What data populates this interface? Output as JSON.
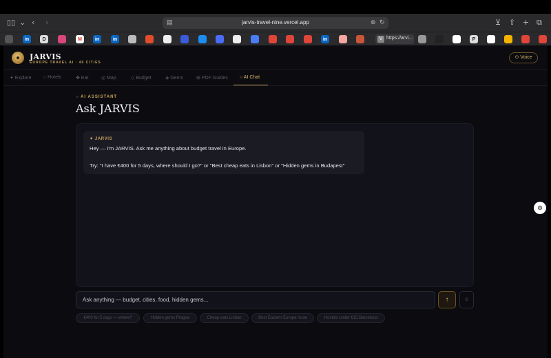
{
  "browser": {
    "url": "jarvis-travel-nine.vercel.app",
    "active_tab_label": "https://arvi..."
  },
  "app": {
    "brand_name": "JARVIS",
    "brand_subtitle": "EUROPE TRAVEL AI · 40 CITIES",
    "voice_button": "⊙ Voice"
  },
  "nav": {
    "items": [
      {
        "label": "✦ Explore"
      },
      {
        "label": "⌂ Hotels"
      },
      {
        "label": "✤ Eat"
      },
      {
        "label": "◎ Map"
      },
      {
        "label": "◇ Budget"
      },
      {
        "label": "◈ Gems"
      },
      {
        "label": "⊞ PDF Guides"
      },
      {
        "label": "○ AI Chat"
      }
    ]
  },
  "main": {
    "eyebrow": "○ AI ASSISTANT",
    "title": "Ask JARVIS"
  },
  "chat": {
    "messages": [
      {
        "sender": "✦ JARVIS",
        "line1": "Hey — I'm JARVIS. Ask me anything about budget travel in Europe.",
        "line2": "Try: \"I have €400 for 5 days, where should I go?\" or \"Best cheap eats in Lisbon\" or \"Hidden gems in Budapest\""
      }
    ],
    "input_placeholder": "Ask anything — budget, cities, food, hidden gems...",
    "send_icon": "↑",
    "mic_icon": "⊙"
  },
  "suggestions": [
    "€400 for 5 days — where?",
    "Hidden gems Prague",
    "Cheap eats Lisbon",
    "Best Eastern Europe route",
    "Hostels under €15 Barcelona"
  ],
  "colors": {
    "accent": "#c9a45a",
    "background": "#0b0b10",
    "panel": "#12121a"
  }
}
